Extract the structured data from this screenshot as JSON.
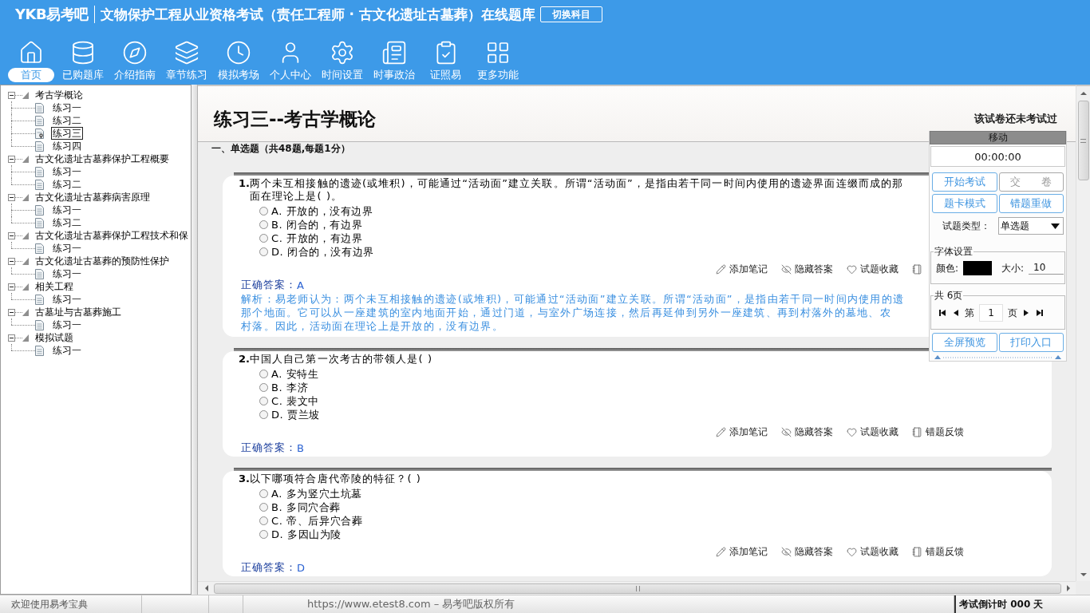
{
  "header": {
    "logo": "YKB易考吧",
    "title": "文物保护工程从业资格考试（责任工程师 · 古文化遗址古墓葬）在线题库",
    "switch_button": "切换科目"
  },
  "nav": [
    {
      "label": "首页",
      "selected": true
    },
    {
      "label": "已购题库",
      "selected": false
    },
    {
      "label": "介绍指南",
      "selected": false
    },
    {
      "label": "章节练习",
      "selected": false
    },
    {
      "label": "模拟考场",
      "selected": false
    },
    {
      "label": "个人中心",
      "selected": false
    },
    {
      "label": "时间设置",
      "selected": false
    },
    {
      "label": "时事政治",
      "selected": false
    },
    {
      "label": "证照易",
      "selected": false
    },
    {
      "label": "更多功能",
      "selected": false
    }
  ],
  "tree": [
    {
      "label": "考古学概论",
      "expanded": true,
      "children": [
        {
          "label": "练习一",
          "selected": false
        },
        {
          "label": "练习二",
          "selected": false
        },
        {
          "label": "练习三",
          "selected": true
        },
        {
          "label": "练习四",
          "selected": false
        }
      ]
    },
    {
      "label": "古文化遗址古墓葬保护工程概要",
      "expanded": true,
      "children": [
        {
          "label": "练习一",
          "selected": false
        },
        {
          "label": "练习二",
          "selected": false
        }
      ]
    },
    {
      "label": "古文化遗址古墓葬病害原理",
      "expanded": true,
      "children": [
        {
          "label": "练习一",
          "selected": false
        },
        {
          "label": "练习二",
          "selected": false
        }
      ]
    },
    {
      "label": "古文化遗址古墓葬保护工程技术和保",
      "expanded": true,
      "children": [
        {
          "label": "练习一",
          "selected": false
        }
      ]
    },
    {
      "label": "古文化遗址古墓葬的预防性保护",
      "expanded": true,
      "children": [
        {
          "label": "练习一",
          "selected": false
        }
      ]
    },
    {
      "label": "相关工程",
      "expanded": true,
      "children": [
        {
          "label": "练习一",
          "selected": false
        }
      ]
    },
    {
      "label": "古墓址与古墓葬施工",
      "expanded": true,
      "children": [
        {
          "label": "练习一",
          "selected": false
        }
      ]
    },
    {
      "label": "模拟试题",
      "expanded": true,
      "children": [
        {
          "label": "练习一",
          "selected": false
        }
      ]
    }
  ],
  "exam": {
    "title": "练习三--考古学概论",
    "status": "该试卷还未考试过",
    "section": "一、单选题（共48题,每题1分）",
    "questions": [
      {
        "number": "1.",
        "stem_lines": [
          "两个未互相接触的遗迹(或堆积)，可能通过“活动面”建立关联。所谓“活动面”，是指由若干同一时间内使用的遗迹界面连缀而成的那",
          "面在理论上是( )。"
        ],
        "options": [
          {
            "text": "A. 开放的，没有边界",
            "selected": false
          },
          {
            "text": "B. 闭合的，有边界",
            "selected": false
          },
          {
            "text": "C. 开放的，有边界",
            "selected": false
          },
          {
            "text": "D. 闭合的，没有边界",
            "selected": false
          }
        ],
        "actions": [
          {
            "kind": "note",
            "label": "添加笔记"
          },
          {
            "kind": "hide",
            "label": "隐藏答案"
          },
          {
            "kind": "favorite",
            "label": "试题收藏"
          },
          {
            "kind": "feedback"
          }
        ],
        "answer_label": "正确答案：",
        "answer": "A",
        "analysis_lines": [
          "解析：易老师认为：两个未互相接触的遗迹(或堆积)，可能通过“活动面”建立关联。所谓“活动面”，是指由若干同一时间内使用的遗",
          "那个地面。它可以从一座建筑的室内地面开始，通过门道，与室外广场连接，然后再延伸到另外一座建筑、再到村落外的墓地、农",
          "村落。因此，活动面在理论上是开放的，没有边界。"
        ]
      },
      {
        "number": "2.",
        "stem_lines": [
          "中国人自己第一次考古的带领人是( )"
        ],
        "options": [
          {
            "text": "A. 安特生",
            "selected": false
          },
          {
            "text": "B. 李济",
            "selected": false
          },
          {
            "text": "C. 裴文中",
            "selected": false
          },
          {
            "text": "D. 贾兰坡",
            "selected": false
          }
        ],
        "actions": [
          {
            "kind": "note",
            "label": "添加笔记"
          },
          {
            "kind": "hide",
            "label": "隐藏答案"
          },
          {
            "kind": "favorite",
            "label": "试题收藏"
          },
          {
            "kind": "feedback",
            "label": "错题反馈"
          }
        ],
        "answer_label": "正确答案：",
        "answer": "B"
      },
      {
        "number": "3.",
        "stem_lines": [
          "以下哪项符合唐代帝陵的特征？( )"
        ],
        "options": [
          {
            "text": "A. 多为竖穴土坑墓",
            "selected": false
          },
          {
            "text": "B. 多同穴合葬",
            "selected": false
          },
          {
            "text": "C. 帝、后异穴合葬",
            "selected": false
          },
          {
            "text": "D. 多因山为陵",
            "selected": false
          }
        ],
        "actions": [
          {
            "kind": "note",
            "label": "添加笔记"
          },
          {
            "kind": "hide",
            "label": "隐藏答案"
          },
          {
            "kind": "favorite",
            "label": "试题收藏"
          },
          {
            "kind": "feedback",
            "label": "错题反馈"
          }
        ],
        "answer_label": "正确答案：",
        "answer": "D"
      }
    ]
  },
  "panel": {
    "title": "移动",
    "timer": "00:00:00",
    "buttons": [
      {
        "label": "开始考试",
        "disabled": false
      },
      {
        "label": "交　　卷",
        "disabled": true
      },
      {
        "label": "题卡模式",
        "disabled": false
      },
      {
        "label": "错题重做",
        "disabled": false
      }
    ],
    "type_label": "试题类型：",
    "type_value": "单选题",
    "font_settings": {
      "legend": "字体设置",
      "color_label": "颜色:",
      "color": "#000000",
      "size_label": "大小:",
      "size": "10"
    },
    "pager": {
      "legend": "共 6页",
      "prefix": "第",
      "page": "1",
      "suffix": "页"
    },
    "bottom_buttons": [
      "全屏预览",
      "打印入口"
    ]
  },
  "status_bar": {
    "welcome": "欢迎使用易考宝典",
    "copyright": "https://www.etest8.com – 易考吧版权所有",
    "countdown": "考试倒计时 000 天"
  }
}
